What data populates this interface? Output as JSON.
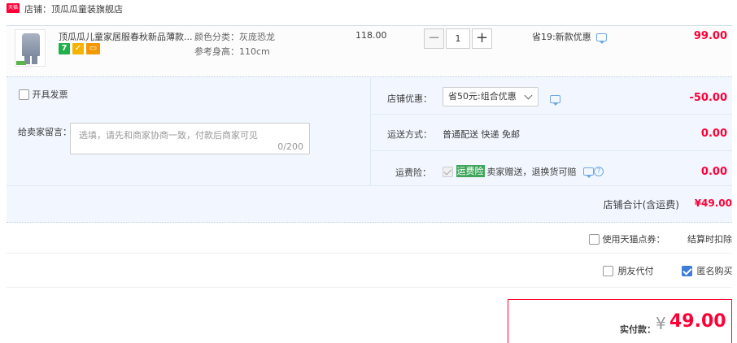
{
  "shop": {
    "badge": "天猫",
    "name": "店铺：顶瓜瓜童装旗舰店"
  },
  "item": {
    "title": "顶瓜瓜儿童家居服春秋新品薄款...",
    "icons": [
      "7",
      "shield-icon",
      "card-icon"
    ],
    "sku_color": "颜色分类：灰庞恐龙",
    "sku_height": "参考身高：110cm",
    "price": "118.00",
    "qty_minus": "−",
    "qty": "1",
    "qty_plus": "+",
    "promo": "省19:新款优惠",
    "subtotal": "99.00"
  },
  "invoice": {
    "label": "开具发票"
  },
  "message": {
    "label": "给卖家留言：",
    "placeholder": "选填，请先和商家协商一致，付款后商家可见",
    "counter": "0/200"
  },
  "store_discount": {
    "label": "店铺优惠：",
    "selected": "省50元:组合优惠",
    "amount": "-50.00"
  },
  "shipping": {
    "label": "运送方式：",
    "value": "普通配送 快递 免邮",
    "amount": "0.00"
  },
  "insurance": {
    "label": "运费险：",
    "tag": "运费险",
    "text": "卖家赠送，退换货可赔",
    "help": "?",
    "amount": "0.00"
  },
  "store_total": {
    "label": "店铺合计(含运费)",
    "value": "¥49.00"
  },
  "tmall_points": {
    "label": "使用天猫点券：",
    "note": "结算时扣除"
  },
  "options": {
    "friend_pay": "朋友代付",
    "anonymous": "匿名购买"
  },
  "payment": {
    "label": "实付款：",
    "currency": "¥",
    "amount": "49.00"
  },
  "colors": {
    "accent_red": "#ff0036",
    "link_blue": "#3d7cd9",
    "panel_bg": "#f2f7ff"
  }
}
